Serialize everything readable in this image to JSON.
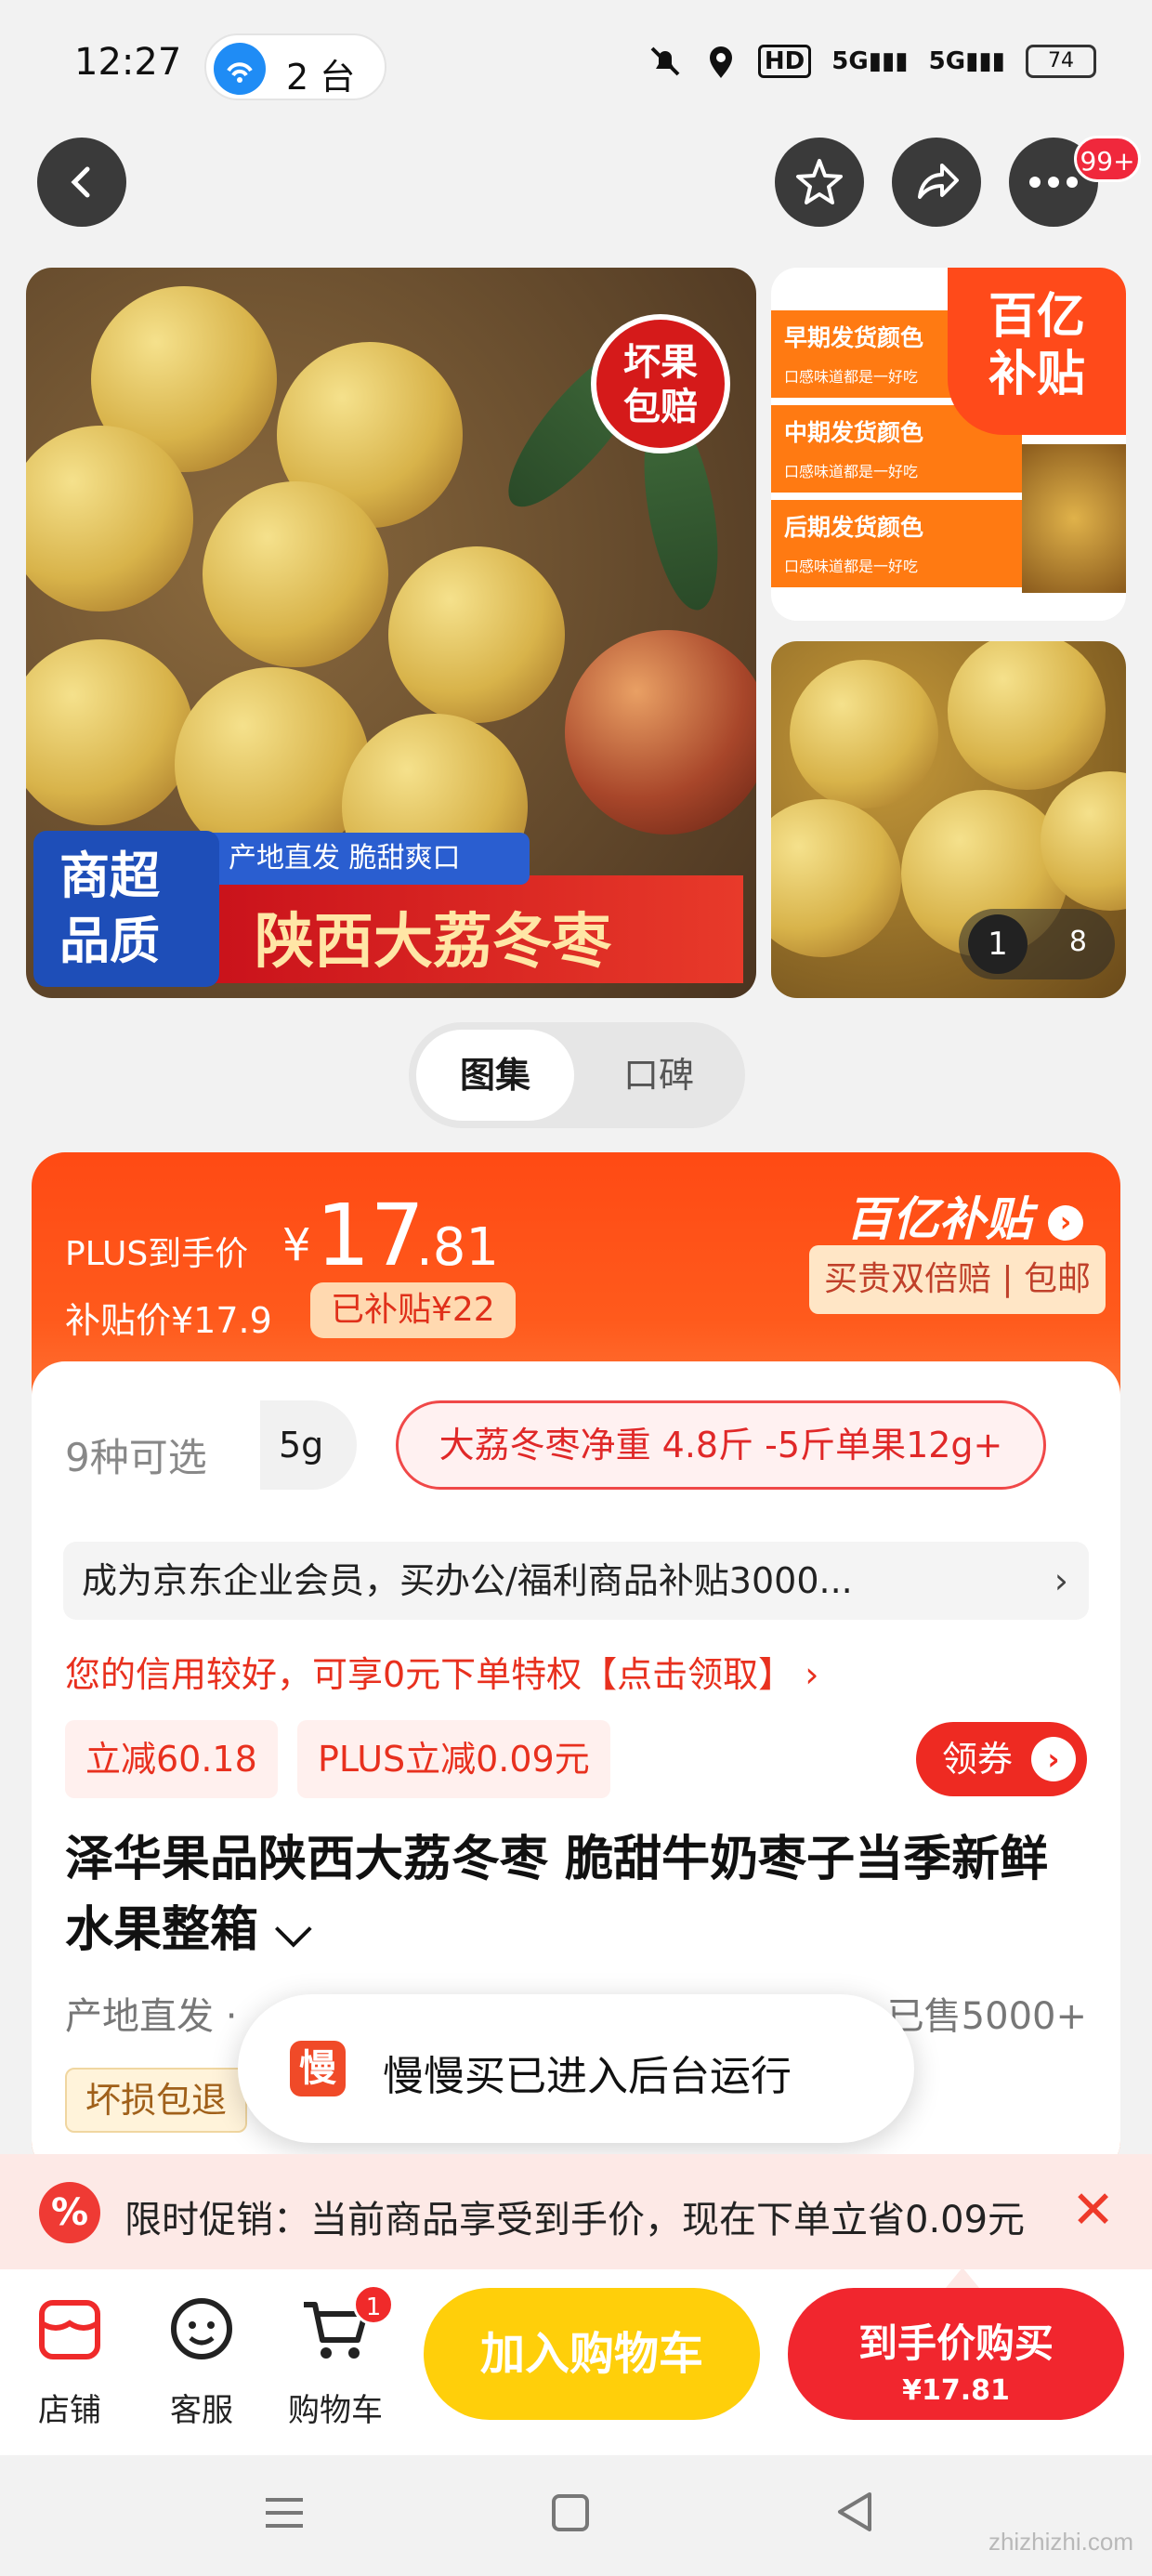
{
  "status_bar": {
    "time": "12:27",
    "hotspot": "2 台",
    "battery": "74",
    "hd": "HD",
    "net1": "5G",
    "net2": "5G"
  },
  "nav": {
    "more_badge": "99+"
  },
  "gallery": {
    "seal": "坏果\n包赔",
    "banner_main": "陕西大荔冬枣",
    "banner_sub": "产地直发 脆甜爽口",
    "quality": "商超\n品质",
    "thumb_rows": [
      {
        "t1": "早期发货颜色",
        "t2": "口感味道都是一好吃"
      },
      {
        "t1": "中期发货颜色",
        "t2": "口感味道都是一好吃"
      },
      {
        "t1": "后期发货颜色",
        "t2": "口感味道都是一好吃"
      }
    ],
    "thumb_badge": "百亿\n补贴",
    "counter_current": "1",
    "counter_total": "8"
  },
  "tabs": [
    {
      "label": "图集",
      "active": true
    },
    {
      "label": "口碑",
      "active": false
    }
  ],
  "price": {
    "plus_label": "PLUS到手价",
    "currency": "¥",
    "int": "17",
    "dec": ".81",
    "subsidy_label": "补贴价¥17.9",
    "subsidy_tag": "已补贴¥22",
    "program_logo": "百亿补贴",
    "program_tag": "买贵双倍赔 | 包邮"
  },
  "options": {
    "count": "9种可选",
    "chip1": "5g",
    "chip2": "大荔冬枣净重 4.8斤 -5斤单果12g+"
  },
  "enterprise": {
    "text": "成为京东企业会员，买办公/福利商品补贴3000...",
    "chevron": "›"
  },
  "credit": "您的信用较好，可享0元下单特权【点击领取】 ›",
  "discounts": [
    "立减60.18",
    "PLUS立减0.09元"
  ],
  "coupon_btn": "领券",
  "product": {
    "title": "泽华果品陕西大荔冬枣 脆甜牛奶枣子当季新鲜水果整箱",
    "title_suffix": " ⌵",
    "origin": "产地直发 ·",
    "sold": "已售5000+",
    "damage_tag": "坏损包退"
  },
  "toast": {
    "icon": "慢",
    "text": "慢慢买已进入后台运行"
  },
  "promo": {
    "icon": "%",
    "text": "限时促销：当前商品享受到手价，现在下单立省0.09元",
    "close": "✕"
  },
  "bottom": {
    "shop": "店铺",
    "service": "客服",
    "cart": "购物车",
    "cart_badge": "1",
    "add_cart": "加入购物车",
    "buy_now": "到手价购买",
    "buy_price": "¥17.81"
  },
  "watermark": "zhizhizhi.com",
  "colors": {
    "accent_red": "#f1262e",
    "price_orange": "#ff4a14",
    "cart_yellow": "#ffcf0a"
  }
}
